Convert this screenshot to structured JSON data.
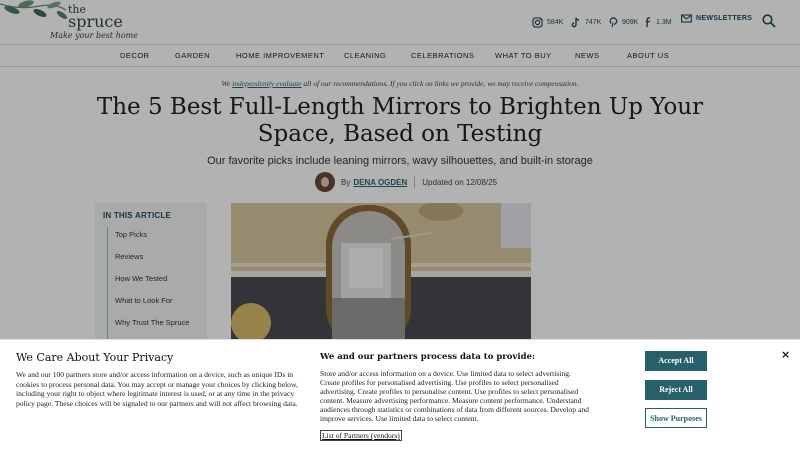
{
  "header": {
    "logo_line1": "the",
    "logo_line2": "spruce",
    "logo_tagline": "Make your best home",
    "social": [
      {
        "icon": "instagram-icon",
        "count": "584K"
      },
      {
        "icon": "tiktok-icon",
        "count": "747K"
      },
      {
        "icon": "pinterest-icon",
        "count": "909K"
      },
      {
        "icon": "facebook-icon",
        "count": "1.3M"
      }
    ],
    "newsletters_label": "NEWSLETTERS"
  },
  "nav": {
    "items": [
      "DECOR",
      "GARDEN",
      "HOME IMPROVEMENT",
      "CLEANING",
      "CELEBRATIONS",
      "WHAT TO BUY",
      "NEWS",
      "ABOUT US"
    ]
  },
  "article": {
    "disclaimer_pre": "We ",
    "disclaimer_link": "independently evaluate",
    "disclaimer_post": " all of our recommendations. If you click on links we provide, we may receive compensation.",
    "title": "The 5 Best Full-Length Mirrors to Brighten Up Your Space, Based on Testing",
    "subtitle": "Our favorite picks include leaning mirrors, wavy silhouettes, and built-in storage",
    "by": "By",
    "author": "DENA OGDEN",
    "updated": "Updated on 12/08/25"
  },
  "toc": {
    "title": "IN THIS ARTICLE",
    "items": [
      "Top Picks",
      "Reviews",
      "How We Tested",
      "What to Look For",
      "Why Trust The Spruce"
    ]
  },
  "consent": {
    "title": "We Care About Your Privacy",
    "body": "We and our 100 partners store and/or access information on a device, such as unique IDs in cookies to process personal data. You may accept or manage your choices by clicking below, including your right to object where legitimate interest is used, or at any time in the privacy policy page. These choices will be signaled to our partners and will not affect browsing data.",
    "purposes_title": "We and our partners process data to provide:",
    "purposes_body": "Store and/or access information on a device. Use limited data to select advertising. Create profiles for personalised advertising. Use profiles to select personalised advertising. Create profiles to personalise content. Use profiles to select personalised content. Measure advertising performance. Measure content performance. Understand audiences through statistics or combinations of data from different sources. Develop and improve services. Use limited data to select content.",
    "partners_link": "List of Partners (vendors)",
    "accept_label": "Accept All",
    "reject_label": "Reject All",
    "purposes_label": "Show Purposes",
    "close_label": "×"
  },
  "colors": {
    "brand_teal": "#26606b",
    "link": "#2a6470",
    "icon_navy": "#1f4c5e"
  }
}
